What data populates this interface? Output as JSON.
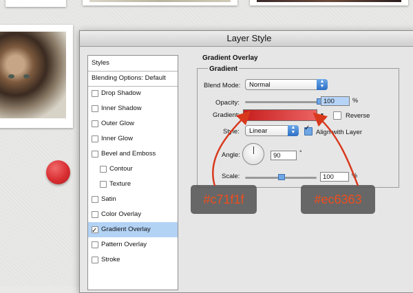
{
  "dialog": {
    "title": "Layer Style",
    "styles_header": "Styles",
    "items": [
      {
        "label": "Blending Options: Default",
        "checkbox": false,
        "checked": false,
        "indent": false,
        "selected": false
      },
      {
        "label": "Drop Shadow",
        "checkbox": true,
        "checked": false,
        "indent": false,
        "selected": false
      },
      {
        "label": "Inner Shadow",
        "checkbox": true,
        "checked": false,
        "indent": false,
        "selected": false
      },
      {
        "label": "Outer Glow",
        "checkbox": true,
        "checked": false,
        "indent": false,
        "selected": false
      },
      {
        "label": "Inner Glow",
        "checkbox": true,
        "checked": false,
        "indent": false,
        "selected": false
      },
      {
        "label": "Bevel and Emboss",
        "checkbox": true,
        "checked": false,
        "indent": false,
        "selected": false
      },
      {
        "label": "Contour",
        "checkbox": true,
        "checked": false,
        "indent": true,
        "selected": false
      },
      {
        "label": "Texture",
        "checkbox": true,
        "checked": false,
        "indent": true,
        "selected": false
      },
      {
        "label": "Satin",
        "checkbox": true,
        "checked": false,
        "indent": false,
        "selected": false
      },
      {
        "label": "Color Overlay",
        "checkbox": true,
        "checked": false,
        "indent": false,
        "selected": false
      },
      {
        "label": "Gradient Overlay",
        "checkbox": true,
        "checked": true,
        "indent": false,
        "selected": true
      },
      {
        "label": "Pattern Overlay",
        "checkbox": true,
        "checked": false,
        "indent": false,
        "selected": false
      },
      {
        "label": "Stroke",
        "checkbox": true,
        "checked": false,
        "indent": false,
        "selected": false
      }
    ]
  },
  "panel": {
    "section_title": "Gradient Overlay",
    "group_title": "Gradient",
    "blend_mode_label": "Blend Mode:",
    "blend_mode_value": "Normal",
    "opacity_label": "Opacity:",
    "opacity_value": "100",
    "opacity_unit": "%",
    "opacity_level": 1.0,
    "gradient_label": "Gradient:",
    "gradient_start_color": "#c71f1f",
    "gradient_end_color": "#ec6363",
    "reverse_label": "Reverse",
    "reverse_checked": false,
    "style_label": "Style:",
    "style_value": "Linear",
    "align_label": "Align with Layer",
    "align_checked": true,
    "angle_label": "Angle:",
    "angle_value": "90",
    "angle_unit": "°",
    "scale_label": "Scale:",
    "scale_value": "100",
    "scale_unit": "%",
    "scale_level": 0.5
  },
  "annotations": {
    "left_color": "#c71f1f",
    "right_color": "#ec6363",
    "annotation_text_color": "#ee4e1e",
    "arrow_color": "#d8391d"
  },
  "icons": {
    "dropdown": "chevron-updown-icon",
    "gradient_dropdown": "triangle-down-icon",
    "angle": "angle-dial-icon"
  }
}
